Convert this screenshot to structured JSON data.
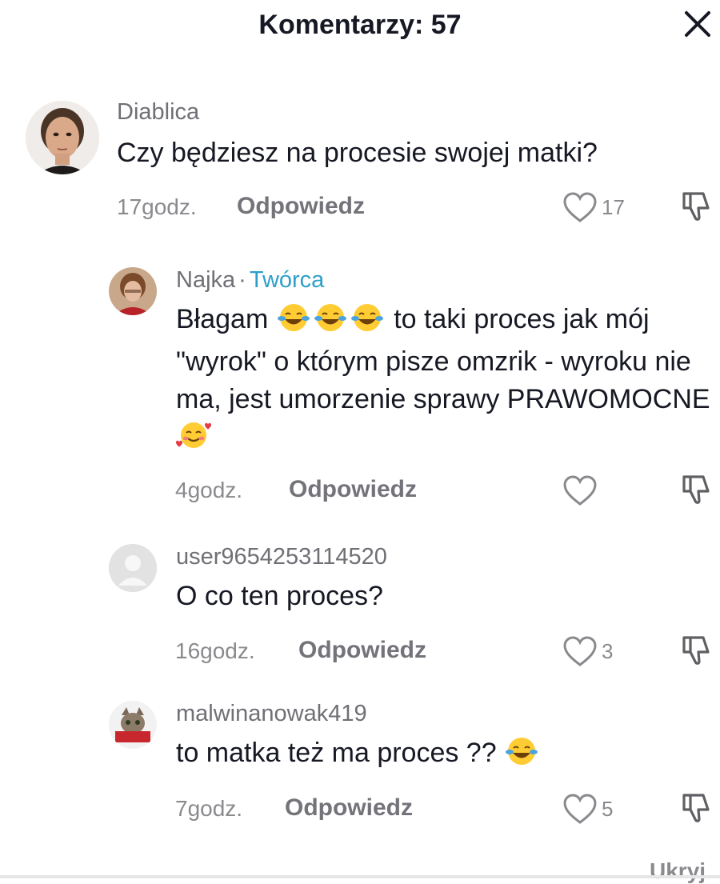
{
  "header": {
    "title": "Komentarzy: 57",
    "close_icon": "close-icon"
  },
  "comments": [
    {
      "username": "Diablica",
      "text": "Czy będziesz na procesie swojej matki?",
      "time": "17godz.",
      "reply_label": "Odpowiedz",
      "likes": "17"
    },
    {
      "username": "Najka",
      "separator": "·",
      "badge": "Twórca",
      "text_intro": "Błagam",
      "text_main": "to taki proces jak mój \"wyrok\" o którym pisze omzrik - wyroku nie ma, jest umorzenie sprawy PRAWOMOCNE",
      "time": "4godz.",
      "reply_label": "Odpowiedz",
      "likes": ""
    },
    {
      "username": "user9654253114520",
      "text": "O co ten proces?",
      "time": "16godz.",
      "reply_label": "Odpowiedz",
      "likes": "3"
    },
    {
      "username": "malwinanowak419",
      "text": "to matka też ma proces ??",
      "time": "7godz.",
      "reply_label": "Odpowiedz",
      "likes": "5"
    }
  ],
  "footer": {
    "hide_label": "Ukryj"
  },
  "colors": {
    "creator": "#2f9fc8",
    "text": "#161823",
    "muted": "#8a8a8e"
  }
}
